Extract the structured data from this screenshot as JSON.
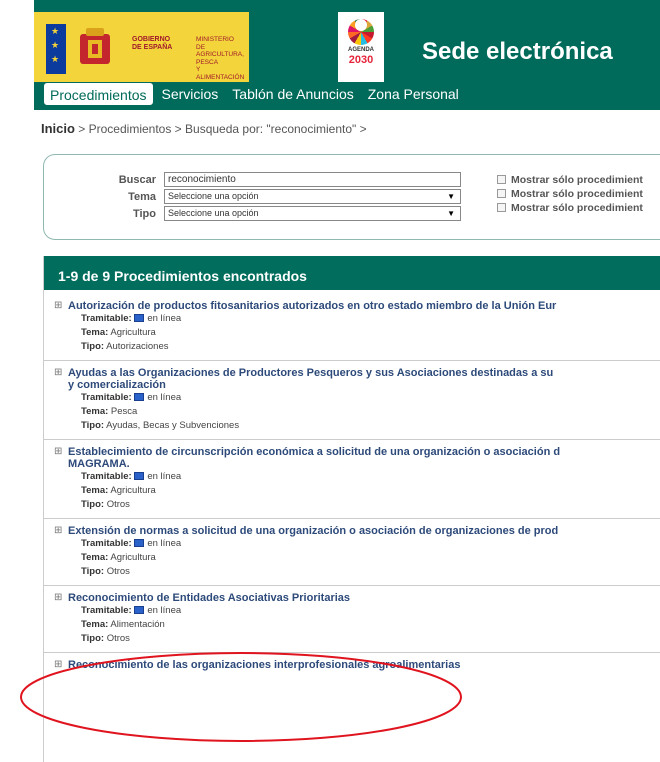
{
  "header": {
    "gobierno": "GOBIERNO\nDE ESPAÑA",
    "ministerio": "MINISTERIO\nDE AGRICULTURA, PESCA\nY ALIMENTACIÓN",
    "agenda_label": "AGENDA",
    "agenda_year": "2030",
    "site_title": "Sede electrónica",
    "nav": [
      "Procedimientos",
      "Servicios",
      "Tablón de Anuncios",
      "Zona Personal"
    ]
  },
  "breadcrumb": {
    "home": "Inicio",
    "rest": " > Procedimientos > Busqueda por: \"reconocimiento\" >"
  },
  "search": {
    "buscar_label": "Buscar",
    "buscar_value": "reconocimiento",
    "tema_label": "Tema",
    "tema_value": "Seleccione una opción",
    "tipo_label": "Tipo",
    "tipo_value": "Seleccione una opción",
    "checks": [
      "Mostrar sólo procedimient",
      "Mostrar sólo procedimient",
      "Mostrar sólo procedimient"
    ]
  },
  "results": {
    "header": "1-9 de 9 Procedimientos encontrados",
    "tramitable_label": "Tramitable:",
    "tramitable_value": "en línea",
    "tema_label": "Tema:",
    "tipo_label": "Tipo:",
    "items": [
      {
        "title": "Autorización de productos fitosanitarios autorizados en otro estado miembro de la Unión Eur",
        "tema": "Agricultura",
        "tipo": "Autorizaciones"
      },
      {
        "title": "Ayudas a las Organizaciones de Productores Pesqueros y sus Asociaciones destinadas a su\ny comercialización",
        "tema": "Pesca",
        "tipo": "Ayudas, Becas y Subvenciones"
      },
      {
        "title": "Establecimiento de circunscripción económica a solicitud de una organización o asociación d\nMAGRAMA.",
        "tema": "Agricultura",
        "tipo": "Otros"
      },
      {
        "title": "Extensión de normas a solicitud de una organización o asociación de organizaciones de prod",
        "tema": "Agricultura",
        "tipo": "Otros"
      },
      {
        "title": "Reconocimiento de Entidades Asociativas Prioritarias",
        "tema": "Alimentación",
        "tipo": "Otros"
      },
      {
        "title": "Reconocimiento de las organizaciones interprofesionales agroalimentarias"
      }
    ]
  },
  "colors": {
    "header_green": "#006b5a",
    "gob_yellow": "#f3d53b",
    "highlight_red": "#e0141e",
    "link_blue": "#2d4a7a"
  }
}
